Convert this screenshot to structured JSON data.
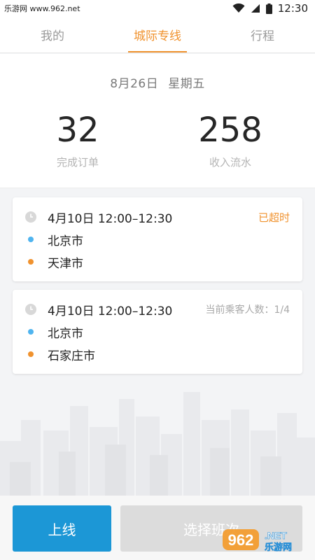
{
  "status_bar": {
    "watermark_text": "乐游网 www.962.net",
    "time": "12:30",
    "icons": [
      "wifi-icon",
      "cellular-signal-icon",
      "battery-icon"
    ]
  },
  "tabs": [
    {
      "label": "我的",
      "active": false
    },
    {
      "label": "城际专线",
      "active": true
    },
    {
      "label": "行程",
      "active": false
    }
  ],
  "summary": {
    "date": "8月26日",
    "weekday": "星期五",
    "orders_value": "32",
    "orders_label": "完成订单",
    "income_value": "258",
    "income_label": "收入流水"
  },
  "trips": [
    {
      "time": "4月10日 12:00–12:30",
      "status": "已超时",
      "from": "北京市",
      "to": "天津市"
    },
    {
      "time": "4月10日 12:00–12:30",
      "status": "当前乘客人数：1/4",
      "from": "北京市",
      "to": "石家庄市"
    }
  ],
  "actions": {
    "online_label": "上线",
    "select_label": "选择班次"
  },
  "colors": {
    "accent": "#f0922e",
    "primary_button": "#1c97d6",
    "disabled_button": "#dcdcdc",
    "origin_dot": "#4fb4ef",
    "destination_dot": "#f0922e"
  },
  "watermark": {
    "logo_text": "962",
    "logo_sub": "乐游网",
    "logo_net": ".NET"
  }
}
